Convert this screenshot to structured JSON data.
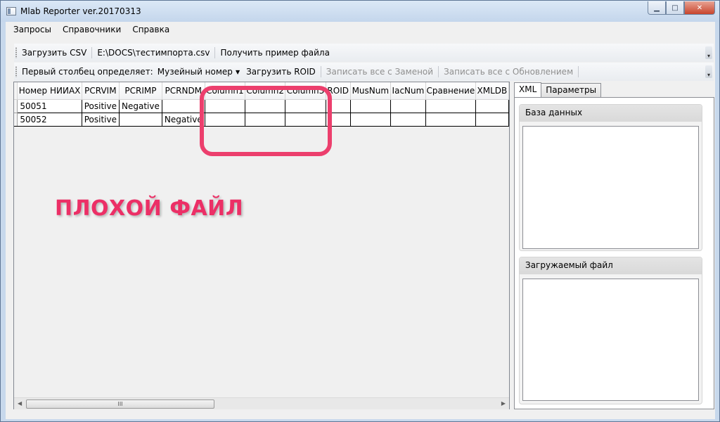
{
  "window": {
    "title": "Mlab Reporter ver.20170313"
  },
  "menu": [
    "Запросы",
    "Справочники",
    "Справка"
  ],
  "toolbar1": {
    "load_csv": "Загрузить CSV",
    "file_path": "E:\\DOCS\\тестимпорта.csv",
    "get_sample": "Получить пример файла"
  },
  "toolbar2": {
    "first_col_label": "Первый столбец определяет:",
    "first_col_value": "Музейный номер",
    "load_roid": "Загрузить ROID",
    "write_replace": "Записать все с Заменой",
    "write_update": "Записать все с Обновлением"
  },
  "grid": {
    "columns": [
      "Номер НИИАХ",
      "PCRVIM",
      "PCRIMP",
      "PCRNDM",
      "Column1",
      "Column2",
      "Column3",
      "ROID",
      "MusNum",
      "IacNum",
      "Сравнение",
      "XMLDB"
    ],
    "rows": [
      [
        "50051",
        "Positive",
        "Negative",
        "",
        "",
        "",
        "",
        "",
        "",
        "",
        "",
        ""
      ],
      [
        "50052",
        "Positive",
        "",
        "Negative",
        "",
        "",
        "",
        "",
        "",
        "",
        "",
        ""
      ]
    ],
    "scroll_thumb": "III"
  },
  "annotation": {
    "text": "ПЛОХОЙ ФАЙЛ",
    "color": "#ec2f66"
  },
  "tabs": [
    "XML",
    "Параметры"
  ],
  "panel": {
    "db_title": "База данных",
    "file_title": "Загружаемый файл"
  }
}
